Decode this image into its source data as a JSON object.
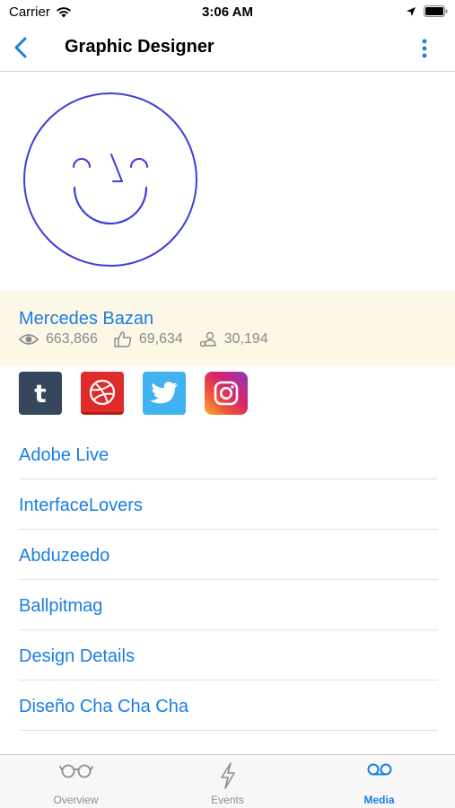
{
  "status_bar": {
    "carrier": "Carrier",
    "time": "3:06 AM"
  },
  "nav": {
    "title": "Graphic Designer"
  },
  "profile": {
    "name": "Mercedes Bazan",
    "views": "663,866",
    "likes": "69,634",
    "followers": "30,194"
  },
  "social": [
    {
      "name": "tumblr",
      "icon": "tumblr-icon"
    },
    {
      "name": "dribbble",
      "icon": "dribbble-icon"
    },
    {
      "name": "twitter",
      "icon": "twitter-icon"
    },
    {
      "name": "instagram",
      "icon": "instagram-icon"
    }
  ],
  "links": [
    {
      "label": "Adobe Live"
    },
    {
      "label": "InterfaceLovers"
    },
    {
      "label": "Abduzeedo"
    },
    {
      "label": "Ballpitmag"
    },
    {
      "label": "Design Details"
    },
    {
      "label": "Diseño Cha Cha Cha"
    }
  ],
  "tabs": [
    {
      "label": "Overview",
      "icon": "glasses-icon",
      "active": false
    },
    {
      "label": "Events",
      "icon": "lightning-icon",
      "active": false
    },
    {
      "label": "Media",
      "icon": "voicemail-icon",
      "active": true
    }
  ],
  "colors": {
    "accent": "#1a7ee3",
    "avatar_stroke": "#3d3dd9",
    "profile_bg": "#fdf7e6"
  }
}
